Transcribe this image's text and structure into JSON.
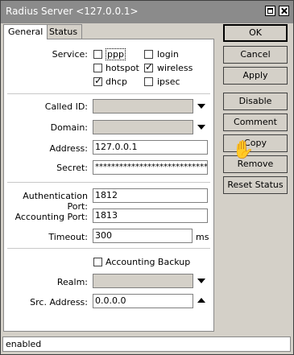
{
  "window": {
    "title": "Radius Server <127.0.0.1>"
  },
  "tabs": [
    {
      "label": "General"
    },
    {
      "label": "Status"
    }
  ],
  "form": {
    "service_label": "Service:",
    "services": [
      {
        "label": "ppp",
        "checked": false
      },
      {
        "label": "login",
        "checked": false
      },
      {
        "label": "hotspot",
        "checked": false
      },
      {
        "label": "wireless",
        "checked": true
      },
      {
        "label": "dhcp",
        "checked": true
      },
      {
        "label": "ipsec",
        "checked": false
      }
    ],
    "called_id_label": "Called ID:",
    "called_id_value": "",
    "domain_label": "Domain:",
    "domain_value": "",
    "address_label": "Address:",
    "address_value": "127.0.0.1",
    "secret_label": "Secret:",
    "secret_value": "****************************",
    "auth_port_label": "Authentication Port:",
    "auth_port_value": "1812",
    "acct_port_label": "Accounting Port:",
    "acct_port_value": "1813",
    "timeout_label": "Timeout:",
    "timeout_value": "300",
    "timeout_unit": "ms",
    "accounting_backup_label": "Accounting Backup",
    "accounting_backup_checked": false,
    "realm_label": "Realm:",
    "realm_value": "",
    "src_address_label": "Src. Address:",
    "src_address_value": "0.0.0.0"
  },
  "buttons": {
    "ok": "OK",
    "cancel": "Cancel",
    "apply": "Apply",
    "disable": "Disable",
    "comment": "Comment",
    "copy": "Copy",
    "remove": "Remove",
    "reset_status": "Reset Status"
  },
  "status": {
    "text": "enabled"
  },
  "icons": {
    "cursor": "hand-cursor-icon"
  }
}
